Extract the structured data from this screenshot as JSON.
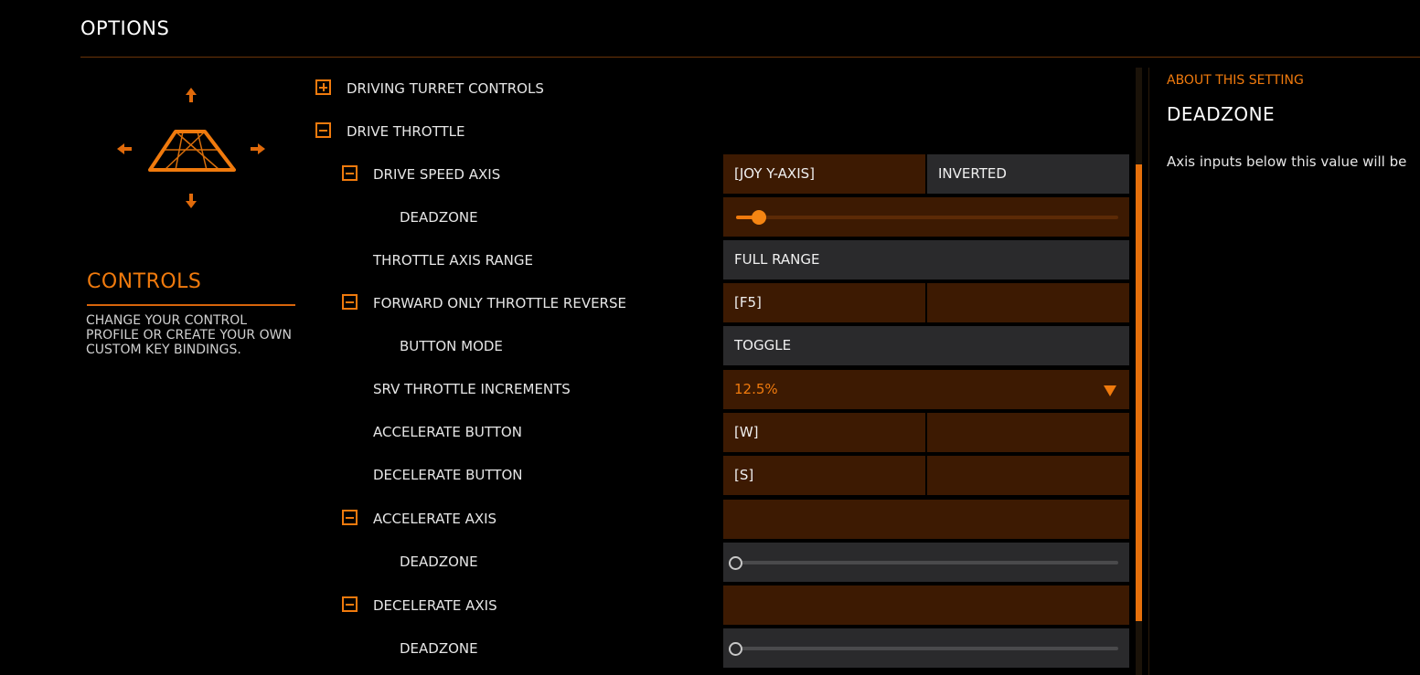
{
  "header": {
    "title": "OPTIONS"
  },
  "section": {
    "title": "CONTROLS",
    "description": "CHANGE YOUR CONTROL PROFILE OR CREATE YOUR OWN CUSTOM KEY BINDINGS."
  },
  "rows": {
    "driving_turret_controls": {
      "label": "DRIVING TURRET CONTROLS",
      "expanded": false
    },
    "drive_throttle": {
      "label": "DRIVE THROTTLE",
      "expanded": true
    },
    "drive_speed_axis": {
      "label": "DRIVE SPEED AXIS",
      "binding": "[JOY Y-AXIS]",
      "modifier": "INVERTED"
    },
    "drive_speed_deadzone": {
      "label": "DEADZONE",
      "value": 0.06
    },
    "throttle_axis_range": {
      "label": "THROTTLE AXIS RANGE",
      "value": "FULL RANGE"
    },
    "forward_only_throttle_reverse": {
      "label": "FORWARD ONLY THROTTLE REVERSE",
      "binding": "[F5]",
      "secondary": ""
    },
    "button_mode": {
      "label": "BUTTON MODE",
      "value": "TOGGLE"
    },
    "srv_throttle_increments": {
      "label": "SRV THROTTLE INCREMENTS",
      "value": "12.5%"
    },
    "accelerate_button": {
      "label": "ACCELERATE BUTTON",
      "binding": "[W]",
      "secondary": ""
    },
    "decelerate_button": {
      "label": "DECELERATE BUTTON",
      "binding": "[S]",
      "secondary": ""
    },
    "accelerate_axis": {
      "label": "ACCELERATE AXIS",
      "binding": ""
    },
    "accelerate_deadzone": {
      "label": "DEADZONE",
      "value": 0
    },
    "decelerate_axis": {
      "label": "DECELERATE AXIS",
      "binding": ""
    },
    "decelerate_deadzone": {
      "label": "DEADZONE",
      "value": 0
    }
  },
  "about": {
    "heading": "ABOUT THIS SETTING",
    "title": "DEADZONE",
    "description": "Axis inputs below this value will be"
  },
  "colors": {
    "accent": "#f07a0d",
    "cell_orange": "#3d1a02",
    "cell_gray": "#2a2a2c"
  }
}
